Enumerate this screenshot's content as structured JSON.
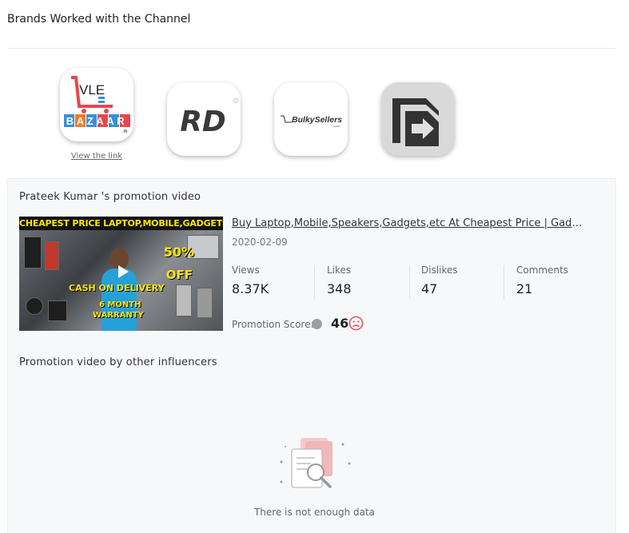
{
  "header": {
    "title": "Brands Worked with the Channel"
  },
  "brands": {
    "items": [
      {
        "name": "VLE BAZAAR",
        "logo_top": "VLE",
        "logo_bottom": "BAZAAR",
        "logo_suffix": ".IN"
      },
      {
        "name": "RD",
        "logo_text": "RD"
      },
      {
        "name": "Bulky Sellers",
        "logo_text": "BulkySellers",
        "logo_sub": ".com"
      },
      {
        "name": "Arrow brand",
        "logo_text": ""
      }
    ],
    "view_link": "View the link"
  },
  "promotion": {
    "title": "Prateek Kumar 's promotion video",
    "thumbnail": {
      "banner": "CHEAPEST PRICE LAPTOP,MOBILE,GADGETS",
      "discount": "50%",
      "off": "OFF",
      "cod": "CASH ON DELIVERY",
      "warranty_1": "6 MONTH",
      "warranty_2": "WARRANTY"
    },
    "video_title": "Buy Laptop,Mobile,Speakers,Gadgets,etc At Cheapest Price | Gadgets",
    "date": "2020-02-09",
    "stats": [
      {
        "label": "Views",
        "value": "8.37K"
      },
      {
        "label": "Likes",
        "value": "348"
      },
      {
        "label": "Dislikes",
        "value": "47"
      },
      {
        "label": "Comments",
        "value": "21"
      }
    ],
    "score_label": "Promotion Score:",
    "score_value": "46",
    "score_icon": "sad-face-icon"
  },
  "others": {
    "title": "Promotion video by other influencers",
    "empty_text": "There is not enough data",
    "empty_icon": "no-data-document-search-icon"
  },
  "colors": {
    "accent_red": "#e5484d",
    "panel_bg": "#f7f8fa",
    "score_dot": "#9aa0a6"
  }
}
